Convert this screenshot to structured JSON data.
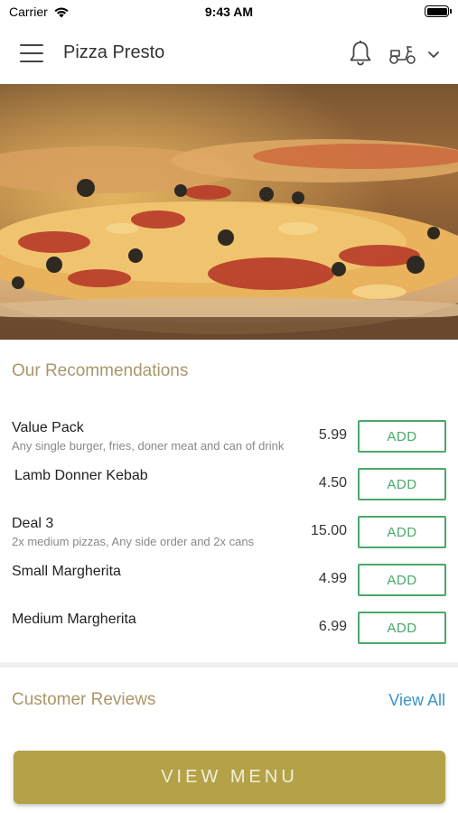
{
  "status_bar": {
    "carrier": "Carrier",
    "time": "9:43 AM"
  },
  "header": {
    "title": "Pizza Presto",
    "icons": [
      "menu-icon",
      "bell-icon",
      "scooter-icon",
      "chevron-down-icon"
    ]
  },
  "hero": {
    "icon": "pizza-photo"
  },
  "recommendations": {
    "title": "Our Recommendations",
    "add_label": "ADD",
    "items": [
      {
        "name": "Value Pack",
        "description": "Any single burger, fries, doner meat and can of drink",
        "price": "5.99"
      },
      {
        "name": "Lamb Donner Kebab",
        "description": "",
        "price": "4.50"
      },
      {
        "name": "Deal 3",
        "description": "2x medium pizzas, Any side order and 2x cans",
        "price": "15.00"
      },
      {
        "name": "Small Margherita",
        "description": "",
        "price": "4.99"
      },
      {
        "name": "Medium Margherita",
        "description": "",
        "price": "6.99"
      }
    ]
  },
  "reviews": {
    "title": "Customer Reviews",
    "view_all_label": "View All"
  },
  "footer": {
    "view_menu_label": "VIEW MENU"
  },
  "colors": {
    "accent_gold": "#b3a248",
    "section_title": "#a9976a",
    "add_green": "#4aa86a",
    "link_blue": "#3996c8"
  }
}
